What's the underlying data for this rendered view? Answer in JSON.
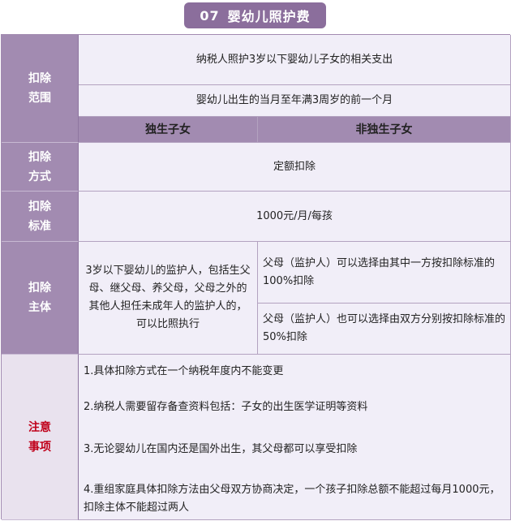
{
  "title": {
    "number": "07",
    "text": "婴幼儿照护费"
  },
  "rows": {
    "scope": {
      "label_line1": "扣除",
      "label_line2": "范围",
      "line1": "纳税人照护3岁以下婴幼儿子女的相关支出",
      "line2": "婴幼儿出生的当月至年满3周岁的前一个月"
    },
    "columns": {
      "only_child": "独生子女",
      "not_only_child": "非独生子女"
    },
    "method": {
      "label_line1": "扣除",
      "label_line2": "方式",
      "value": "定额扣除"
    },
    "standard": {
      "label_line1": "扣除",
      "label_line2": "标准",
      "value": "1000元/月/每孩"
    },
    "subject": {
      "label_line1": "扣除",
      "label_line2": "主体",
      "only_child_text": "3岁以下婴幼儿的监护人，包括生父母、继父母、养父母，父母之外的其他人担任未成年人的监护人的，可以比照执行",
      "option1": "父母（监护人）可以选择由其中一方按扣除标准的100%扣除",
      "option2": "父母（监护人）也可以选择由双方分别按扣除标准的50%扣除"
    },
    "notes": {
      "label_line1": "注意",
      "label_line2": "事项",
      "items": [
        "1.具体扣除方式在一个纳税年度内不能变更",
        "2.纳税人需要留存备查资料包括：子女的出生医学证明等资料",
        "3.无论婴幼儿在国内还是国外出生，其父母都可以享受扣除",
        "4.重组家庭具体扣除方法由父母双方协商决定，一个孩子扣除总额不能超过每月1000元，扣除主体不能超过两人"
      ]
    }
  }
}
